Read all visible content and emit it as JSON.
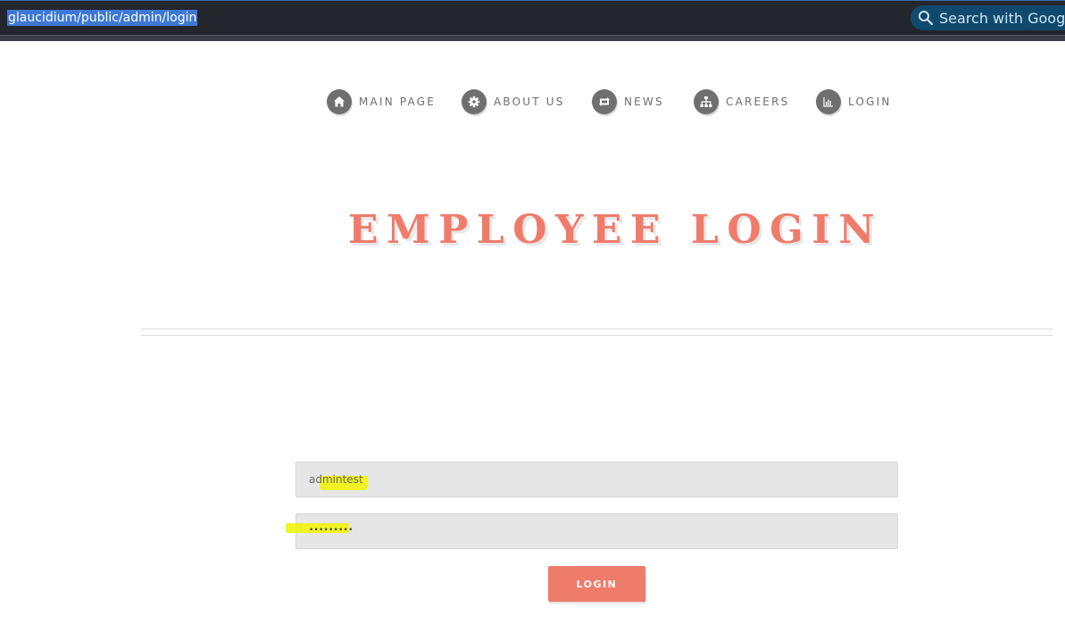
{
  "browser": {
    "url": "glaucidium/public/admin/login",
    "search_label": "Search with Google",
    "search_icon": "search-icon",
    "url_highlight_color": "#3d78d6"
  },
  "nav": {
    "items": [
      {
        "label": "MAIN PAGE",
        "icon": "home-icon"
      },
      {
        "label": "ABOUT US",
        "icon": "gear-icon"
      },
      {
        "label": "NEWS",
        "icon": "retweet-icon"
      },
      {
        "label": "CAREERS",
        "icon": "sitemap-icon"
      },
      {
        "label": "LOGIN",
        "icon": "bar-chart-icon"
      }
    ]
  },
  "page": {
    "title": "EMPLOYEE LOGIN",
    "accent_color": "#ef7b6b"
  },
  "form": {
    "username_value": "admintest",
    "password_mask": "•••••••••",
    "submit_label": "LOGIN",
    "highlight_color": "#f1f300"
  }
}
